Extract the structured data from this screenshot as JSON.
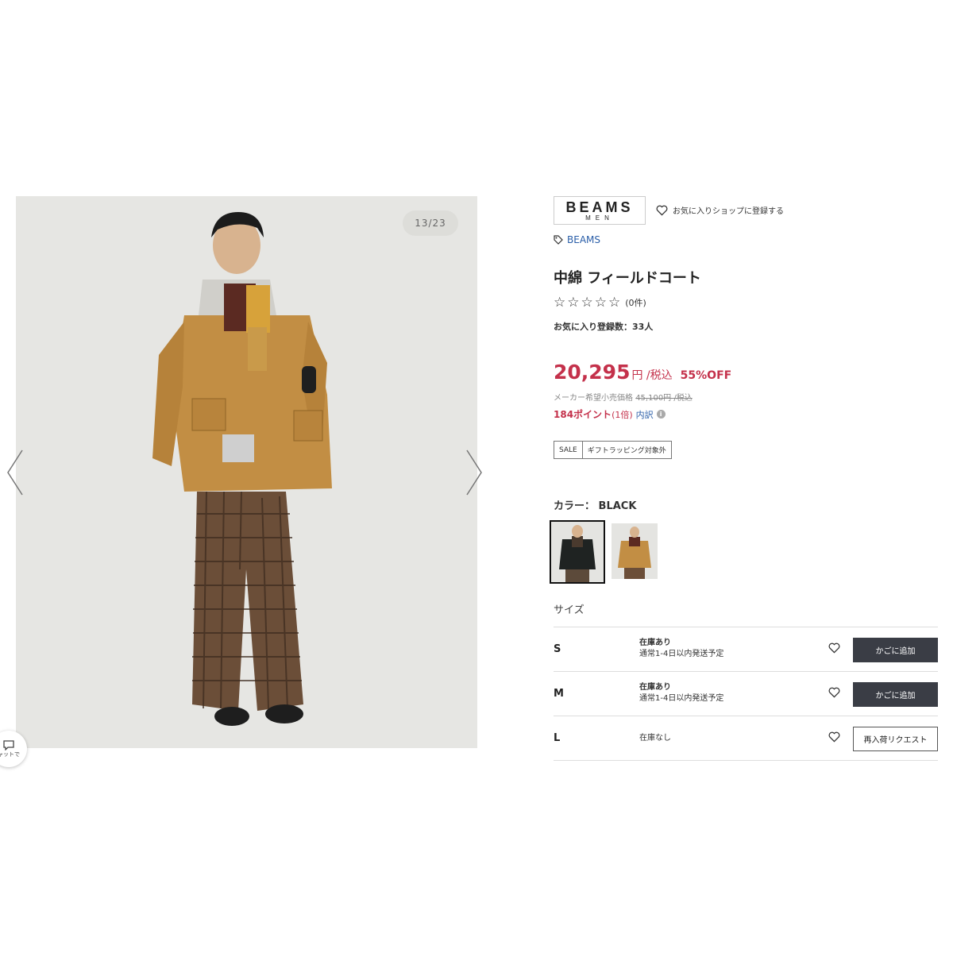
{
  "gallery": {
    "counter": "13/23",
    "chat_label": "ャットで"
  },
  "brand": {
    "logo_line1": "BEAMS",
    "logo_line2": "MEN",
    "fav_shop_label": "お気に入りショップに登録する",
    "tag": "BEAMS"
  },
  "product": {
    "title": "中綿 フィールドコート",
    "rating_count": "(0件)",
    "favorites": "お気に入り登録数：33人",
    "price": "20,295",
    "price_unit": "円 /税込",
    "discount": "55%OFF",
    "msrp_label": "メーカー希望小売価格",
    "msrp_value": "45,100円 /税込",
    "points": "184ポイント",
    "points_rate": "(1倍)",
    "points_detail": "内訳",
    "tags": [
      "SALE",
      "ギフトラッピング対象外"
    ]
  },
  "color": {
    "label": "カラー：",
    "selected": "BLACK"
  },
  "size_section": {
    "label": "サイズ",
    "rows": [
      {
        "size": "S",
        "stock": "在庫あり",
        "shipping": "通常1-4日以内発送予定",
        "button": "かごに追加"
      },
      {
        "size": "M",
        "stock": "在庫あり",
        "shipping": "通常1-4日以内発送予定",
        "button": "かごに追加"
      },
      {
        "size": "L",
        "stock": "在庫なし",
        "shipping": "",
        "button": "再入荷リクエスト"
      }
    ]
  },
  "colors": {
    "accent": "#c4314b",
    "link": "#2a5ea8",
    "button_dark": "#3a3d45"
  }
}
